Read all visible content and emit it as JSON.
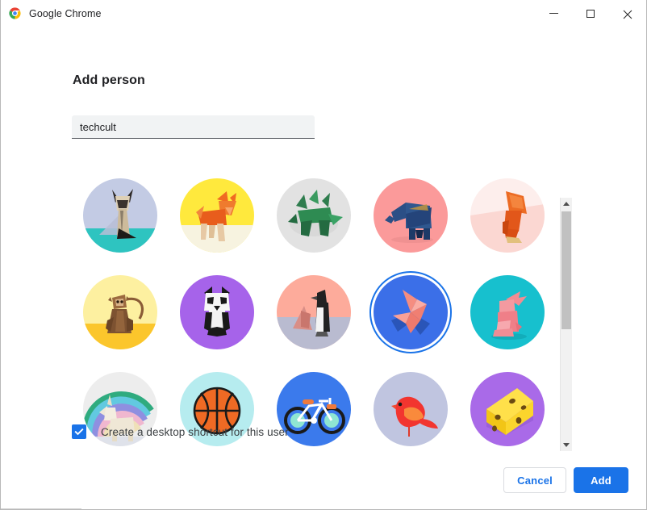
{
  "window": {
    "app_title": "Google Chrome",
    "logo_icon": "chrome-logo-icon",
    "controls": {
      "minimize": "minimize-icon",
      "maximize": "maximize-icon",
      "close": "close-icon"
    }
  },
  "dialog": {
    "title": "Add person",
    "name_input": {
      "value": "techcult",
      "placeholder": ""
    },
    "shortcut": {
      "label": "Create a desktop shortcut for this user",
      "checked": true,
      "check_icon": "checkmark-icon"
    },
    "buttons": {
      "cancel": "Cancel",
      "add": "Add"
    }
  },
  "scrollbar": {
    "up_icon": "caret-up-icon",
    "down_icon": "caret-down-icon",
    "thumb": "scrollbar-thumb"
  },
  "colors": {
    "accent": "#1a73e8",
    "text_primary": "#202124",
    "text_secondary": "#3c4043",
    "input_fill": "#f1f3f4",
    "border": "#dadce0",
    "scroll_track": "#f1f1f1",
    "scroll_thumb": "#c1c1c1"
  },
  "avatars": {
    "selected_index": 8,
    "items": [
      {
        "name": "origami-cat-avatar",
        "label": "Cat",
        "bg": "#c3cbe4",
        "bg2": "#2ec4c0"
      },
      {
        "name": "origami-fox-avatar",
        "label": "Fox",
        "bg": "#ffe93d",
        "bg2": "#f7f3e0"
      },
      {
        "name": "origami-dragon-avatar",
        "label": "Dragon",
        "bg": "#e2e2e2",
        "bg2": "#f0f0f0"
      },
      {
        "name": "origami-elephant-avatar",
        "label": "Elephant",
        "bg": "#fb9a9a",
        "bg2": "#fb9a9a"
      },
      {
        "name": "origami-squirrel-avatar",
        "label": "Squirrel",
        "bg": "#fbe3e0",
        "bg2": "#f9cfc9"
      },
      {
        "name": "origami-monkey-avatar",
        "label": "Monkey",
        "bg": "#fdf0a0",
        "bg2": "#fbc62c"
      },
      {
        "name": "origami-panda-avatar",
        "label": "Panda",
        "bg": "#a663ea",
        "bg2": "#a663ea"
      },
      {
        "name": "origami-penguin-avatar",
        "label": "Penguin",
        "bg": "#fdab9b",
        "bg2": "#b9bbd0"
      },
      {
        "name": "origami-butterfly-avatar",
        "label": "Butterfly",
        "bg": "#3b6fe8",
        "bg2": "#3b6fe8"
      },
      {
        "name": "origami-rabbit-avatar",
        "label": "Rabbit",
        "bg": "#17c0ce",
        "bg2": "#17c0ce"
      },
      {
        "name": "origami-unicorn-avatar",
        "label": "Unicorn",
        "bg": "#e8e8e8",
        "bg2": "#d8dce6"
      },
      {
        "name": "basketball-avatar",
        "label": "Basketball",
        "bg": "#b6ecef",
        "bg2": "#b6ecef"
      },
      {
        "name": "bicycle-avatar",
        "label": "Bicycle",
        "bg": "#3b7aec",
        "bg2": "#3b7aec"
      },
      {
        "name": "bird-avatar",
        "label": "Bird",
        "bg": "#c0c5e0",
        "bg2": "#c0c5e0"
      },
      {
        "name": "cheese-avatar",
        "label": "Cheese",
        "bg": "#a96ae8",
        "bg2": "#a96ae8"
      }
    ]
  }
}
